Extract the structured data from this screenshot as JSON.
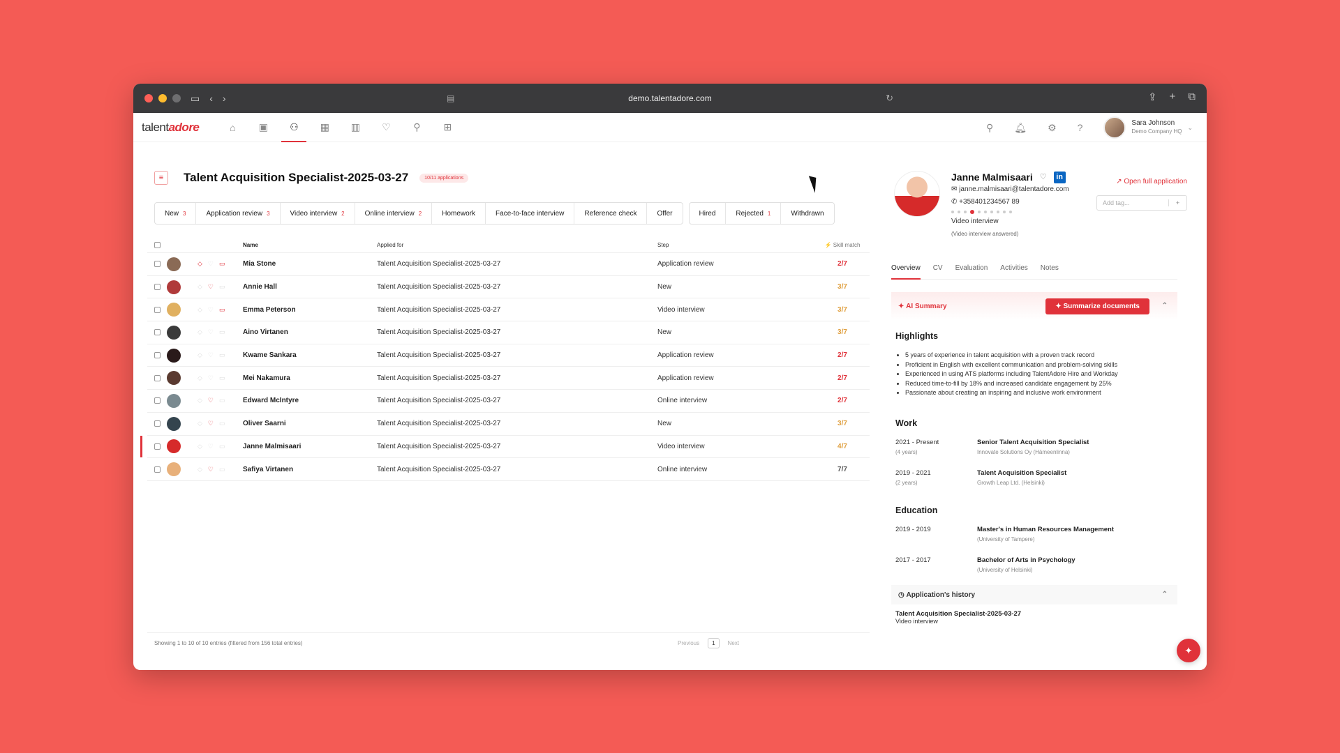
{
  "browser": {
    "url": "demo.talentadore.com"
  },
  "app": {
    "logo_prefix": "talent",
    "logo_brand": "adore",
    "user": {
      "name": "Sara Johnson",
      "org": "Demo Company HQ"
    }
  },
  "job": {
    "title": "Talent Acquisition Specialist-2025-03-27",
    "applications_badge": "10/11 applications"
  },
  "steps": [
    {
      "label": "New",
      "count": "3"
    },
    {
      "label": "Application review",
      "count": "3"
    },
    {
      "label": "Video interview",
      "count": "2"
    },
    {
      "label": "Online interview",
      "count": "2"
    },
    {
      "label": "Homework",
      "count": ""
    },
    {
      "label": "Face-to-face interview",
      "count": ""
    },
    {
      "label": "Reference check",
      "count": ""
    },
    {
      "label": "Offer",
      "count": ""
    }
  ],
  "end_steps": [
    {
      "label": "Hired",
      "count": ""
    },
    {
      "label": "Rejected",
      "count": "1"
    },
    {
      "label": "Withdrawn",
      "count": ""
    }
  ],
  "table": {
    "headers": {
      "name": "Name",
      "applied": "Applied for",
      "step": "Step",
      "skill": "Skill match"
    },
    "rows": [
      {
        "name": "Mia Stone",
        "applied": "Talent Acquisition Specialist-2025-03-27",
        "step": "Application review",
        "skill": "2/7",
        "avatar": "#8a6a55"
      },
      {
        "name": "Annie Hall",
        "applied": "Talent Acquisition Specialist-2025-03-27",
        "step": "New",
        "skill": "3/7",
        "avatar": "#b03a3a"
      },
      {
        "name": "Emma Peterson",
        "applied": "Talent Acquisition Specialist-2025-03-27",
        "step": "Video interview",
        "skill": "3/7",
        "avatar": "#e0b060"
      },
      {
        "name": "Aino Virtanen",
        "applied": "Talent Acquisition Specialist-2025-03-27",
        "step": "New",
        "skill": "3/7",
        "avatar": "#3a3a3a"
      },
      {
        "name": "Kwame Sankara",
        "applied": "Talent Acquisition Specialist-2025-03-27",
        "step": "Application review",
        "skill": "2/7",
        "avatar": "#2a1a1a"
      },
      {
        "name": "Mei Nakamura",
        "applied": "Talent Acquisition Specialist-2025-03-27",
        "step": "Application review",
        "skill": "2/7",
        "avatar": "#5a3a30"
      },
      {
        "name": "Edward McIntyre",
        "applied": "Talent Acquisition Specialist-2025-03-27",
        "step": "Online interview",
        "skill": "2/7",
        "avatar": "#7a8a90"
      },
      {
        "name": "Oliver Saarni",
        "applied": "Talent Acquisition Specialist-2025-03-27",
        "step": "New",
        "skill": "3/7",
        "avatar": "#34444e"
      },
      {
        "name": "Janne Malmisaari",
        "applied": "Talent Acquisition Specialist-2025-03-27",
        "step": "Video interview",
        "skill": "4/7",
        "avatar": "#d62a2a"
      },
      {
        "name": "Safiya Virtanen",
        "applied": "Talent Acquisition Specialist-2025-03-27",
        "step": "Online interview",
        "skill": "7/7",
        "avatar": "#e8b07a"
      }
    ],
    "footer": "Showing 1 to 10 of 10 entries (filtered from 156 total entries)",
    "pager": {
      "prev": "Previous",
      "page": "1",
      "next": "Next"
    }
  },
  "candidate": {
    "name": "Janne Malmisaari",
    "email": "janne.malmisaari@talentadore.com",
    "phone": "+358401234567 89",
    "step": "Video interview",
    "step_note": "(Video interview answered)",
    "open_full": "Open full application",
    "add_tag": "Add tag...",
    "tabs": [
      "Overview",
      "CV",
      "Evaluation",
      "Activities",
      "Notes"
    ],
    "ai_summary": "AI Summary",
    "summarize_btn": "Summarize documents",
    "highlights_title": "Highlights",
    "highlights": [
      "5 years of experience in talent acquisition with a proven track record",
      "Proficient in English with excellent communication and problem-solving skills",
      "Experienced in using ATS platforms including TalentAdore Hire and Workday",
      "Reduced time-to-fill by 18% and increased candidate engagement by 25%",
      "Passionate about creating an inspiring and inclusive work environment"
    ],
    "work_title": "Work",
    "work": [
      {
        "years": "2021 - Present",
        "dur": "(4 years)",
        "title": "Senior Talent Acquisition Specialist",
        "org": "Innovate Solutions Oy (Hämeenlinna)"
      },
      {
        "years": "2019 - 2021",
        "dur": "(2 years)",
        "title": "Talent Acquisition Specialist",
        "org": "Growth Leap Ltd. (Helsinki)"
      }
    ],
    "education_title": "Education",
    "education": [
      {
        "years": "2019 - 2019",
        "title": "Master's in Human Resources Management",
        "org": "(University of Tampere)"
      },
      {
        "years": "2017 - 2017",
        "title": "Bachelor of Arts in Psychology",
        "org": "(University of Helsinki)"
      }
    ],
    "history_title": "Application's history",
    "history_job": "Talent Acquisition Specialist-2025-03-27",
    "history_step": "Video interview"
  }
}
